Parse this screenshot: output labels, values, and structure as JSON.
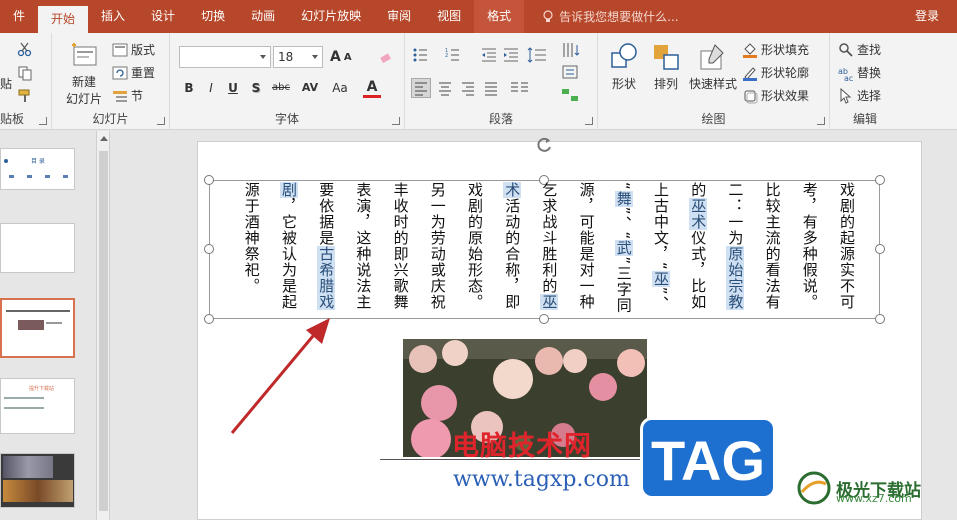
{
  "tabs": [
    "件",
    "开始",
    "插入",
    "设计",
    "切换",
    "动画",
    "幻灯片放映",
    "审阅",
    "视图",
    "格式"
  ],
  "active_tab": "开始",
  "tell_me": "告诉我您想要做什么...",
  "login": "登录",
  "clipboard": {
    "paste": "贴",
    "label": "贴板"
  },
  "slides_group": {
    "new_slide": "新建",
    "new_slide2": "幻灯片",
    "layout": "版式",
    "reset": "重置",
    "section": "节",
    "label": "幻灯片"
  },
  "font_group": {
    "font_name": "",
    "font_size": "18",
    "label": "字体",
    "bold": "B",
    "italic": "I",
    "underline": "U",
    "shadow": "S",
    "strike": "abc",
    "spacing": "AV",
    "case": "Aa",
    "color": "A"
  },
  "paragraph_group": {
    "label": "段落"
  },
  "drawing_group": {
    "shapes": "形状",
    "arrange": "排列",
    "quick_styles": "快速样式",
    "fill": "形状填充",
    "outline": "形状轮廓",
    "effects": "形状效果",
    "label": "绘图"
  },
  "editing_group": {
    "find": "查找",
    "replace": "替换",
    "select": "选择",
    "label": "编辑"
  },
  "thumbnails": [
    {
      "title": "目 录"
    },
    {
      "title": ""
    },
    {
      "title": ""
    },
    {
      "title": "提升下载站"
    },
    {
      "title": ""
    }
  ],
  "text_columns": [
    [
      "戏剧的起源实不可"
    ],
    [
      "考，有多种假说。"
    ],
    [
      "比较主流的看法有"
    ],
    [
      "二：一为",
      "原始宗教",
      ""
    ],
    [
      "的",
      "巫术",
      "仪式，比如"
    ],
    [
      "上古中文，“",
      "巫",
      "”、"
    ],
    [
      "“",
      "舞",
      "”、“",
      "武",
      "”三字同"
    ],
    [
      "源，可能是对一种"
    ],
    [
      "乞求战斗胜利的",
      "巫",
      ""
    ],
    [
      "",
      "术",
      "活动的合称，即"
    ],
    [
      "戏剧的原始形态。"
    ],
    [
      "另一为劳动或庆祝"
    ],
    [
      "丰收时的即兴歌舞"
    ],
    [
      "表演，这种说法主"
    ],
    [
      "要依据是",
      "古希腊戏",
      ""
    ],
    [
      "",
      "剧",
      "，它被认为是起"
    ],
    [
      "源于酒神祭祀。"
    ]
  ],
  "watermark": {
    "cn": "电脑技术网",
    "url": "www.tagxp.com",
    "tag": "TAG",
    "site": "极光下载站",
    "site_url": "www.xz7.com"
  },
  "colors": {
    "accent": "#b7472a",
    "highlight": "#cfe0f2",
    "arrow": "#c0292a"
  }
}
